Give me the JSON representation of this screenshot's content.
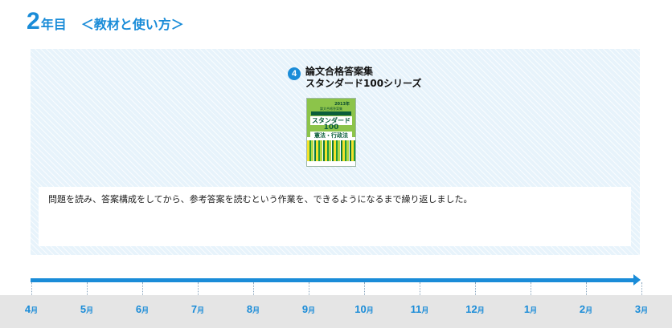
{
  "header": {
    "number": "2",
    "suffix": "年目",
    "subtitle": "＜教材と使い方＞"
  },
  "material": {
    "badge": "4",
    "title_line1": "論文合格答案集",
    "title_line2": "スタンダード100シリーズ",
    "book_cover": {
      "year": "2013年",
      "series": "論文合格答案集",
      "name": "スタンダード",
      "number": "100",
      "subject": "憲法・行政法"
    }
  },
  "description": "問題を読み、答案構成をしてから、参考答案を読むという作業を、できるようになるまで繰り返しました。",
  "timeline": {
    "month_suffix": "月",
    "months": [
      "4",
      "5",
      "6",
      "7",
      "8",
      "9",
      "10",
      "11",
      "12",
      "1",
      "2",
      "3"
    ]
  },
  "colors": {
    "accent": "#1a8cd8",
    "panel": "#e7f3fb",
    "footer": "#e5e5e5"
  }
}
